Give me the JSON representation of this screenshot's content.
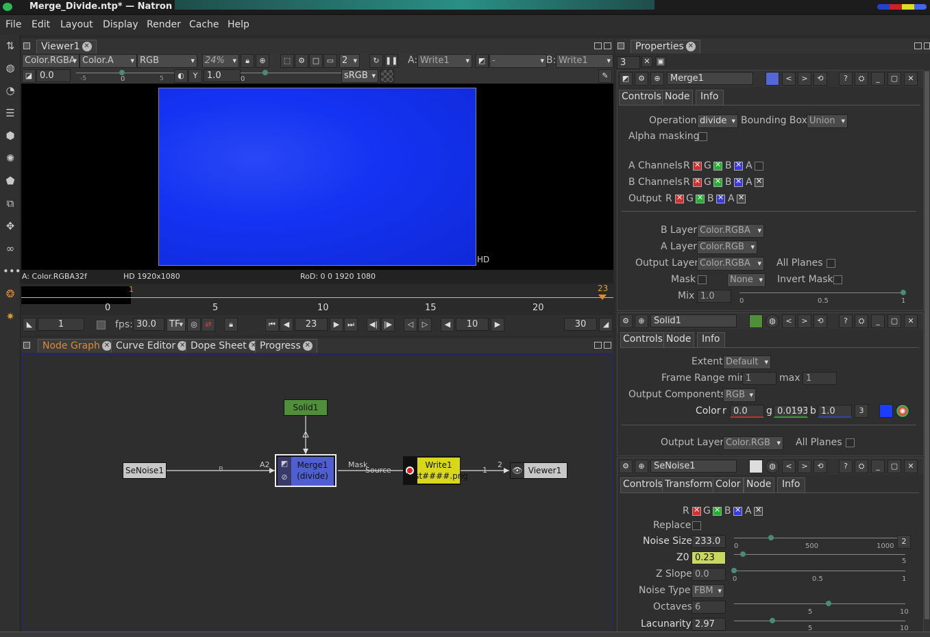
{
  "window": {
    "title": "Merge_Divide.ntp* — Natron"
  },
  "menu": [
    "File",
    "Edit",
    "Layout",
    "Display",
    "Render",
    "Cache",
    "Help"
  ],
  "viewer": {
    "tab": "Viewer1",
    "layer": "Color.RGBA",
    "alpha": "Color.A",
    "channels": "RGB",
    "zoom": "24%",
    "proxy": "2",
    "a_label": "A:",
    "a_input": "Write1",
    "wipe": "-",
    "b_label": "B:",
    "b_input": "Write1",
    "gain": "0.0",
    "gamma": "1.0",
    "colorspace": "sRGB",
    "ruler_ticks": [
      "-5",
      "0",
      "5"
    ],
    "gamma_tick": "0",
    "hd_label": "HD",
    "info_left": "A: Color.RGBA32f",
    "info_format": "HD 1920x1080",
    "info_rod": "RoD: 0 0 1920 1080",
    "image_color": "#1433f2"
  },
  "timeline": {
    "ticks": [
      "0",
      "5",
      "10",
      "15",
      "20"
    ],
    "current_marker": "23",
    "start_marker": "1",
    "start": "1",
    "fps_label": "fps:",
    "fps": "30.0",
    "tf": "TF",
    "current": "23",
    "step": "10",
    "end": "30"
  },
  "nodegraph": {
    "tabs": [
      "Node Graph",
      "Curve Editor",
      "Dope Sheet",
      "Progress"
    ],
    "nodes": {
      "solid": "Solid1",
      "senoise": "SeNoise1",
      "merge_a": "Merge1",
      "merge_b": "(divide)",
      "write_a": "Write1",
      "write_b": "test####.png",
      "viewer": "Viewer1"
    },
    "edges": {
      "b": "B",
      "a2": "A2",
      "mask": "Mask",
      "source": "Source",
      "one": "1",
      "two": "2"
    }
  },
  "properties": {
    "tab": "Properties",
    "max_panels": "3",
    "merge": {
      "name": "Merge1",
      "tabs": [
        "Controls",
        "Node",
        "Info"
      ],
      "operation_label": "Operation",
      "operation": "divide",
      "bbox_label": "Bounding Box",
      "bbox": "Union",
      "alpha_masking": "Alpha masking",
      "a_channels": "A Channels",
      "b_channels": "B Channels",
      "output": "Output",
      "r": "R",
      "g": "G",
      "b": "B",
      "a": "A",
      "b_layer_label": "B Layer",
      "b_layer": "Color.RGBA",
      "a_layer_label": "A Layer",
      "a_layer": "Color.RGB",
      "output_layer_label": "Output Layer",
      "output_layer": "Color.RGBA",
      "all_planes": "All Planes",
      "mask_label": "Mask",
      "mask": "None",
      "invert_mask": "Invert Mask",
      "mix_label": "Mix",
      "mix": "1.0",
      "mix_ticks": [
        "0",
        "0.5",
        "1"
      ]
    },
    "solid": {
      "name": "Solid1",
      "tabs": [
        "Controls",
        "Node",
        "Info"
      ],
      "extent_label": "Extent",
      "extent": "Default",
      "frame_range_label": "Frame Range min",
      "min": "1",
      "max_label": "max",
      "max": "1",
      "output_components_label": "Output Components",
      "output_components": "RGB",
      "color_label": "Color",
      "r_label": "r",
      "r": "0.0",
      "g_label": "g",
      "g": "0.0193",
      "b_label": "b",
      "b": "1.0",
      "dim": "3",
      "output_layer_label": "Output Layer",
      "output_layer": "Color.RGB",
      "all_planes": "All Planes",
      "swatch": "#1c3cff"
    },
    "senoise": {
      "name": "SeNoise1",
      "tabs": [
        "Controls",
        "Transform",
        "Color",
        "Node",
        "Info"
      ],
      "r": "R",
      "g": "G",
      "b": "B",
      "a": "A",
      "replace": "Replace",
      "noise_size_label": "Noise Size",
      "noise_size": "233.0",
      "noise_ticks": [
        "0",
        "500",
        "1000"
      ],
      "noise_dim": "2",
      "z0_label": "Z0",
      "z0": "0.23",
      "z0_tick": "5",
      "zslope_label": "Z Slope",
      "zslope": "0.0",
      "zslope_ticks": [
        "0",
        "0.5",
        "1"
      ],
      "noise_type_label": "Noise Type",
      "noise_type": "FBM",
      "octaves_label": "Octaves",
      "octaves": "6",
      "oct_ticks": [
        "5",
        "10"
      ],
      "lacunarity_label": "Lacunarity",
      "lacunarity": "2.97",
      "lac_ticks": [
        "5",
        "10"
      ]
    }
  }
}
